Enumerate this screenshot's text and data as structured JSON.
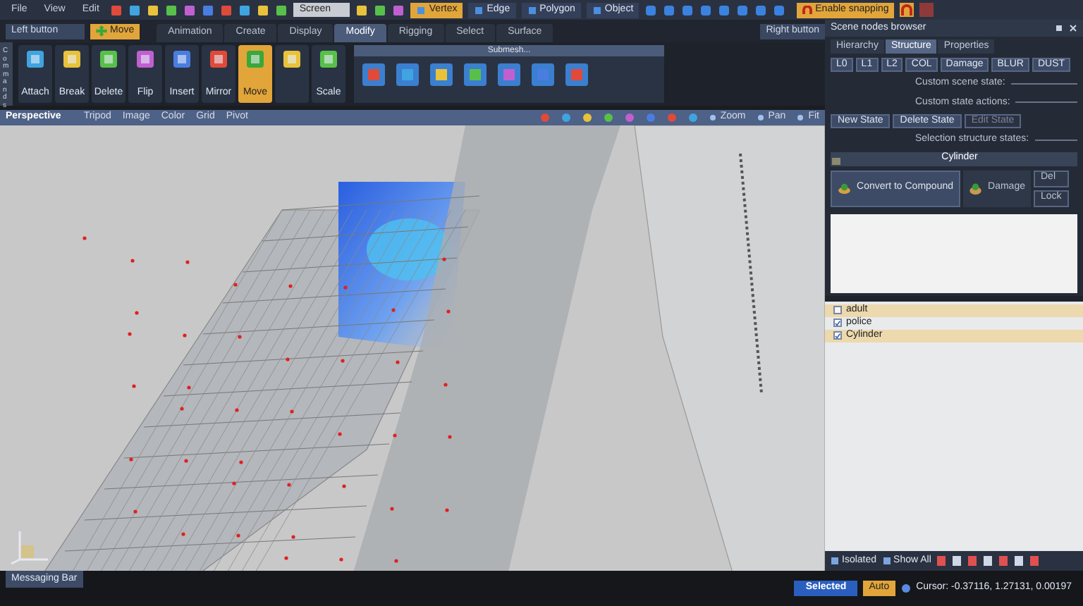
{
  "menu": [
    "File",
    "View",
    "Edit"
  ],
  "top_toolbar": {
    "view_dropdown": "Screen",
    "modes": [
      {
        "label": "Vertex",
        "selected": true
      },
      {
        "label": "Edge",
        "selected": false
      },
      {
        "label": "Polygon",
        "selected": false
      },
      {
        "label": "Object",
        "selected": false
      }
    ],
    "snapping": "Enable snapping",
    "right_button": "Right button"
  },
  "left_button": {
    "label": "Left button",
    "action": "Move"
  },
  "side_tab": "Commands",
  "tabs": [
    {
      "label": "Animation",
      "selected": false
    },
    {
      "label": "Create",
      "selected": false
    },
    {
      "label": "Display",
      "selected": false
    },
    {
      "label": "Modify",
      "selected": true
    },
    {
      "label": "Rigging",
      "selected": false
    },
    {
      "label": "Select",
      "selected": false
    },
    {
      "label": "Surface",
      "selected": false
    }
  ],
  "tools": [
    {
      "label": "Attach",
      "selected": false
    },
    {
      "label": "Break",
      "selected": false
    },
    {
      "label": "Delete",
      "selected": false
    },
    {
      "label": "Flip",
      "selected": false
    },
    {
      "label": "Insert",
      "selected": false
    },
    {
      "label": "Mirror",
      "selected": false
    },
    {
      "label": "Move",
      "selected": true
    },
    {
      "selected": false
    },
    {
      "label": "Scale",
      "selected": false
    }
  ],
  "submesh": {
    "title": "Submesh..."
  },
  "viewport": {
    "title": "Perspective",
    "menu": [
      "Tripod",
      "Image",
      "Color",
      "Grid",
      "Pivot"
    ],
    "nav": [
      "Zoom",
      "Pan",
      "Fit"
    ]
  },
  "browser": {
    "title": "Scene nodes browser",
    "tabs": [
      {
        "label": "Hierarchy",
        "selected": false
      },
      {
        "label": "Structure",
        "selected": true
      },
      {
        "label": "Properties",
        "selected": false
      }
    ],
    "levels": [
      "L0",
      "L1",
      "L2",
      "COL"
    ],
    "damage_dropdown": "Damage",
    "effects": [
      "BLUR",
      "DUST"
    ],
    "scene_state_heading": "Custom scene state:",
    "actions_heading": "Custom state actions:",
    "actions": [
      {
        "label": "New State",
        "disabled": false
      },
      {
        "label": "Delete State",
        "disabled": false
      },
      {
        "label": "Edit State",
        "disabled": true
      }
    ],
    "selection_heading": "Selection structure states:",
    "selection_title": "Cylinder",
    "convert_button": "Convert to Compound",
    "damage_button": "Damage",
    "small_buttons": [
      "Del",
      "Lock"
    ]
  },
  "tree": [
    {
      "label": "adult",
      "checked": false,
      "selected": true
    },
    {
      "label": "police",
      "checked": true,
      "selected": false
    },
    {
      "label": "Cylinder",
      "checked": true,
      "selected": true
    }
  ],
  "tree_footer": [
    "Isolated",
    "Show All"
  ],
  "status_bar": {
    "messaging": "Messaging Bar",
    "selected": "Selected",
    "auto": "Auto",
    "cursor": "Cursor: -0.37116, 1.27131, 0.00197"
  }
}
